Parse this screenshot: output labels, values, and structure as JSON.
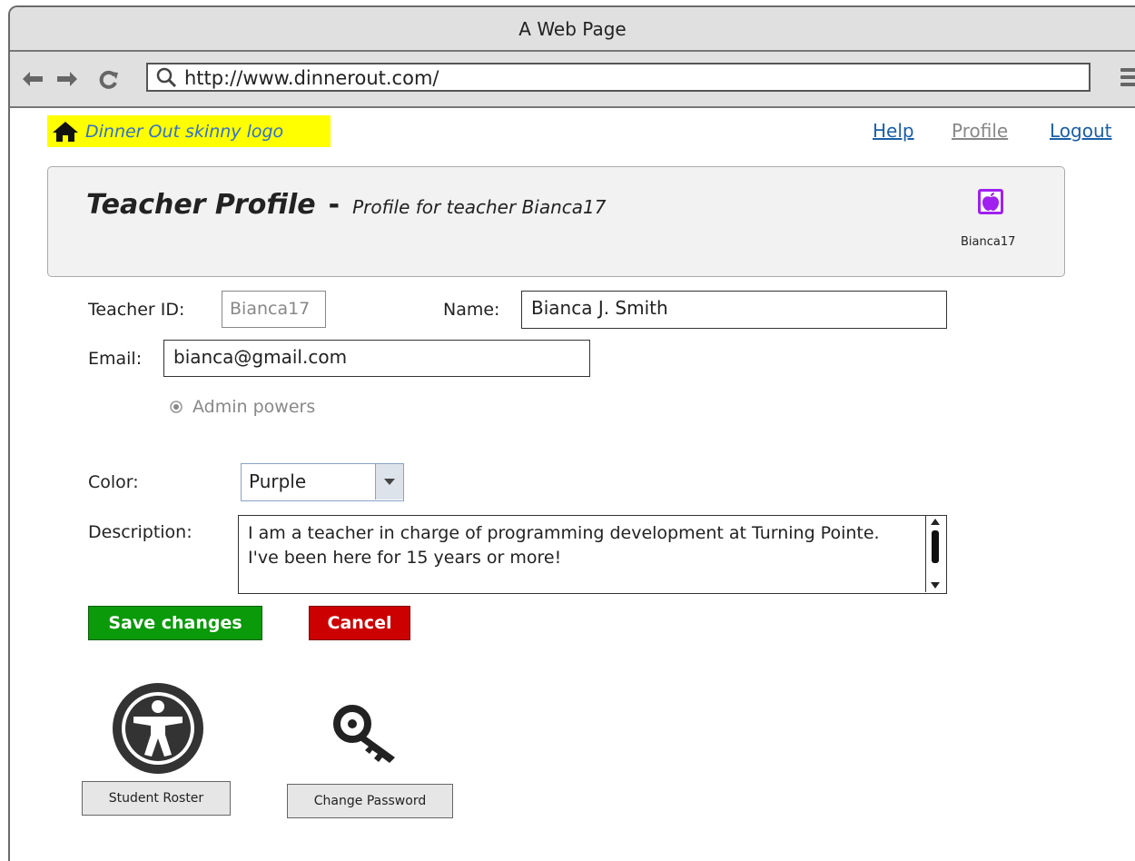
{
  "window": {
    "title": "A Web Page"
  },
  "browser": {
    "url": "http://www.dinnerout.com/",
    "icons": [
      "back-arrow-icon",
      "forward-arrow-icon",
      "reload-icon",
      "search-icon",
      "hamburger-menu-icon"
    ]
  },
  "header": {
    "logo_text": "Dinner Out skinny logo",
    "nav": {
      "help": "Help",
      "profile": "Profile",
      "logout": "Logout"
    }
  },
  "profile_panel": {
    "title": "Teacher Profile",
    "separator": "-",
    "subtitle": "Profile for teacher Bianca17",
    "avatar_caption": "Bianca17",
    "avatar_color": "#a020f0"
  },
  "form": {
    "teacher_id_label": "Teacher ID:",
    "teacher_id_value": "Bianca17",
    "name_label": "Name:",
    "name_value": "Bianca J. Smith",
    "email_label": "Email:",
    "email_value": "bianca@gmail.com",
    "admin_label": "Admin powers",
    "color_label": "Color:",
    "color_value": "Purple",
    "description_label": "Description:",
    "description_value": "I am a teacher in charge of programming development at Turning Pointe. I've been here for 15 years or more!"
  },
  "actions": {
    "save_label": "Save changes",
    "save_color": "#0a9a0a",
    "cancel_label": "Cancel",
    "cancel_color": "#cc0000"
  },
  "tools": {
    "roster_label": "Student Roster",
    "password_label": "Change Password"
  }
}
